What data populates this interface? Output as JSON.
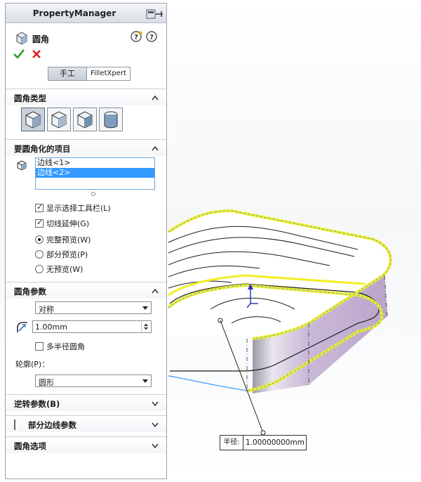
{
  "property_manager": {
    "title": "PropertyManager",
    "feature_name": "圆角",
    "tabs": [
      {
        "label": "手工",
        "active": true
      },
      {
        "label": "FilletXpert",
        "active": false
      }
    ]
  },
  "sections": {
    "fillet_type": {
      "title": "圆角类型",
      "buttons": [
        {
          "name": "constant-size-fillet",
          "selected": true
        },
        {
          "name": "variable-size-fillet",
          "selected": false
        },
        {
          "name": "face-fillet",
          "selected": false
        },
        {
          "name": "full-round-fillet",
          "selected": false
        }
      ]
    },
    "items_to_fillet": {
      "title": "要圆角化的项目",
      "list": [
        {
          "label": "边线<1>",
          "selected": false
        },
        {
          "label": "边线<2>",
          "selected": true
        }
      ],
      "options": [
        {
          "label": "显示选择工具栏(L)",
          "type": "checkbox",
          "checked": true
        },
        {
          "label": "切线延伸(G)",
          "type": "checkbox",
          "checked": true
        },
        {
          "label": "完整预览(W)",
          "type": "radio",
          "checked": true
        },
        {
          "label": "部分预览(P)",
          "type": "radio",
          "checked": false
        },
        {
          "label": "无预览(W)",
          "type": "radio",
          "checked": false
        }
      ]
    },
    "fillet_params": {
      "title": "圆角参数",
      "method": "对称",
      "radius": "1.00mm",
      "multi_radius_label": "多半径圆角",
      "multi_radius_checked": false,
      "profile_label": "轮廓(P)：",
      "profile": "圆形"
    },
    "setback": {
      "title": "逆转参数(B)"
    },
    "partial_edge": {
      "title": "部分边线参数",
      "checked": false
    },
    "fillet_options": {
      "title": "圆角选项"
    }
  },
  "viewport": {
    "dimension": {
      "label": "半径:",
      "value": "1.00000000mm"
    }
  },
  "colors": {
    "accept": "#2e9e2e",
    "cancel": "#d81b1b",
    "highlight_edge": "#f4ee22",
    "selection": "#3399ff",
    "side_face": "#c9b8d6"
  }
}
